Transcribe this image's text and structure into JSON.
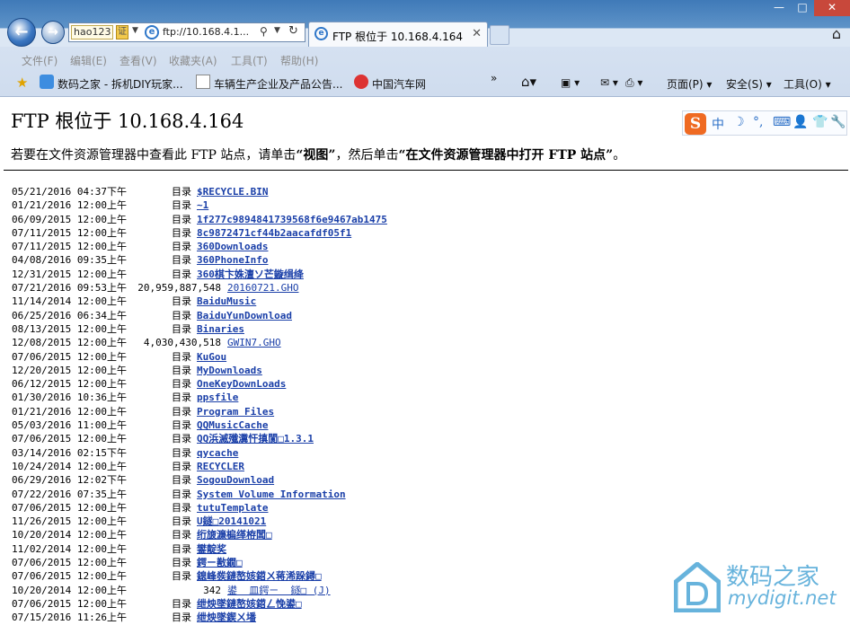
{
  "window": {
    "minimize": "—",
    "maximize": "□",
    "close": "✕"
  },
  "address": {
    "hao123": "hao123",
    "cert": "证",
    "url": "ftp://10.168.4.1..."
  },
  "tab": {
    "title": "FTP 根位于 10.168.4.164"
  },
  "menu": [
    "文件(F)",
    "编辑(E)",
    "查看(V)",
    "收藏夹(A)",
    "工具(T)",
    "帮助(H)"
  ],
  "favorites": [
    "数码之家 - 拆机DIY玩家...",
    "车辆生产企业及产品公告...",
    "中国汽车网"
  ],
  "toolbar": {
    "page": "页面(P) ▾",
    "safety": "安全(S) ▾",
    "tools": "工具(O) ▾",
    "chevron": "»"
  },
  "ime": {
    "s": "S",
    "zh": "中",
    "moon": "☽",
    "dot": "°,",
    "kbd": "⌨",
    "user": "👤",
    "shirt": "👕",
    "wrench": "🔧"
  },
  "page": {
    "title": "FTP 根位于 10.168.4.164",
    "hint_a": "若要在文件资源管理器中查看此 FTP 站点，请单击",
    "hint_b": "“视图”",
    "hint_c": "，然后单击",
    "hint_d": "“在文件资源管理器中打开 FTP 站点”",
    "hint_e": "。"
  },
  "listing": [
    {
      "dt": "05/21/2016 04:37下午",
      "sz": "目录",
      "nm": "$RECYCLE.BIN",
      "dir": true
    },
    {
      "dt": "01/21/2016 12:00上午",
      "sz": "目录",
      "nm": "~1",
      "dir": true
    },
    {
      "dt": "06/09/2015 12:00上午",
      "sz": "目录",
      "nm": "1f277c9894841739568f6e9467ab1475",
      "dir": true
    },
    {
      "dt": "07/11/2015 12:00上午",
      "sz": "目录",
      "nm": "8c9872471cf44b2aacafdf05f1",
      "dir": true
    },
    {
      "dt": "07/11/2015 12:00上午",
      "sz": "目录",
      "nm": "360Downloads",
      "dir": true
    },
    {
      "dt": "04/08/2016 09:35上午",
      "sz": "目录",
      "nm": "360PhoneInfo",
      "dir": true
    },
    {
      "dt": "12/31/2015 12:00上午",
      "sz": "目录",
      "nm": "360棋卞姝澶ソ芒鏇缉绛",
      "dir": true
    },
    {
      "dt": "07/21/2016 09:53上午",
      "sz": "20,959,887,548",
      "nm": "20160721.GHO",
      "dir": false
    },
    {
      "dt": "11/14/2014 12:00上午",
      "sz": "目录",
      "nm": "BaiduMusic",
      "dir": true
    },
    {
      "dt": "06/25/2016 06:34上午",
      "sz": "目录",
      "nm": "BaiduYunDownload",
      "dir": true
    },
    {
      "dt": "08/13/2015 12:00上午",
      "sz": "目录",
      "nm": "Binaries",
      "dir": true
    },
    {
      "dt": "12/08/2015 12:00上午",
      "sz": "4,030,430,518",
      "nm": "GWIN7.GHO",
      "dir": false
    },
    {
      "dt": "07/06/2015 12:00上午",
      "sz": "目录",
      "nm": "KuGou",
      "dir": true
    },
    {
      "dt": "12/20/2015 12:00上午",
      "sz": "目录",
      "nm": "MyDownloads",
      "dir": true
    },
    {
      "dt": "06/12/2015 12:00上午",
      "sz": "目录",
      "nm": "OneKeyDownLoads",
      "dir": true
    },
    {
      "dt": "01/30/2016 10:36上午",
      "sz": "目录",
      "nm": "ppsfile",
      "dir": true
    },
    {
      "dt": "01/21/2016 12:00上午",
      "sz": "目录",
      "nm": "Program Files",
      "dir": true
    },
    {
      "dt": "05/03/2016 11:00上午",
      "sz": "目录",
      "nm": "QQMusicCache",
      "dir": true
    },
    {
      "dt": "07/06/2015 12:00上午",
      "sz": "目录",
      "nm": "QQ浜滅殲瀵忓搷閬□1.3.1",
      "dir": true
    },
    {
      "dt": "03/14/2016 02:15下午",
      "sz": "目录",
      "nm": "qycache",
      "dir": true
    },
    {
      "dt": "10/24/2014 12:00上午",
      "sz": "目录",
      "nm": "RECYCLER",
      "dir": true
    },
    {
      "dt": "06/29/2016 12:02下午",
      "sz": "目录",
      "nm": "SogouDownload",
      "dir": true
    },
    {
      "dt": "07/22/2016 07:35上午",
      "sz": "目录",
      "nm": "System Volume Information",
      "dir": true
    },
    {
      "dt": "07/06/2015 12:00上午",
      "sz": "目录",
      "nm": "tutuTemplate",
      "dir": true
    },
    {
      "dt": "11/26/2015 12:00上午",
      "sz": "目录",
      "nm": "U鐩□20141021",
      "dir": true
    },
    {
      "dt": "10/20/2014 12:00上午",
      "sz": "目录",
      "nm": "绗旇濂楄缂栫闆□",
      "dir": true
    },
    {
      "dt": "11/02/2014 12:00上午",
      "sz": "目录",
      "nm": "鐢靛奖",
      "dir": true
    },
    {
      "dt": "07/06/2015 12:00上午",
      "sz": "目录",
      "nm": "鍔ㄧ敾鐗□",
      "dir": true
    },
    {
      "dt": "07/06/2015 12:00上午",
      "sz": "目录",
      "nm": "鎴峰彂鏈嶅姟鍣ㄨ蒋浠跺鐞□",
      "dir": true
    },
    {
      "dt": "10/20/2014 12:00上午",
      "sz": "342",
      "nm": "鍙  皿鍔ㄧ  鐩□ (J)",
      "dir": false
    },
    {
      "dt": "07/06/2015 12:00上午",
      "sz": "目录",
      "nm": "绁炴墜鏈嶅姟鍣ㄥ悗鍙□",
      "dir": true
    },
    {
      "dt": "07/15/2016 11:26上午",
      "sz": "目录",
      "nm": "绁炴墜鍥ㄨ墦",
      "dir": true
    }
  ],
  "watermark": {
    "t1": "数码之家",
    "t2": "mydigit.net"
  }
}
